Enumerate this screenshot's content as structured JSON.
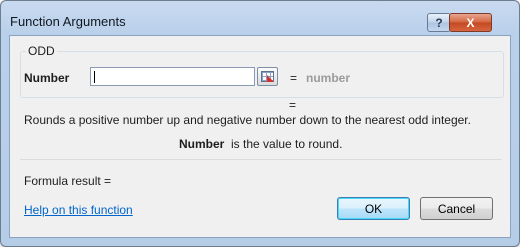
{
  "window": {
    "title": "Function Arguments",
    "help_glyph": "?",
    "close_glyph": "X"
  },
  "function": {
    "name": "ODD",
    "argument_label": "Number",
    "argument_value": "",
    "argument_eval_eq": "=",
    "argument_eval": "number",
    "result_eq": "=",
    "description": "Rounds a positive number up and negative number down to the nearest odd integer.",
    "argument_name": "Number",
    "argument_description": "is the value to round."
  },
  "footer": {
    "formula_result_label": "Formula result =",
    "help_link": "Help on this function",
    "ok_label": "OK",
    "cancel_label": "Cancel"
  },
  "colors": {
    "accent": "#0066cc",
    "close_button": "#c34822",
    "placeholder_text": "#9b9b9b"
  },
  "icons": {
    "collapse_button": "range-select-icon"
  }
}
